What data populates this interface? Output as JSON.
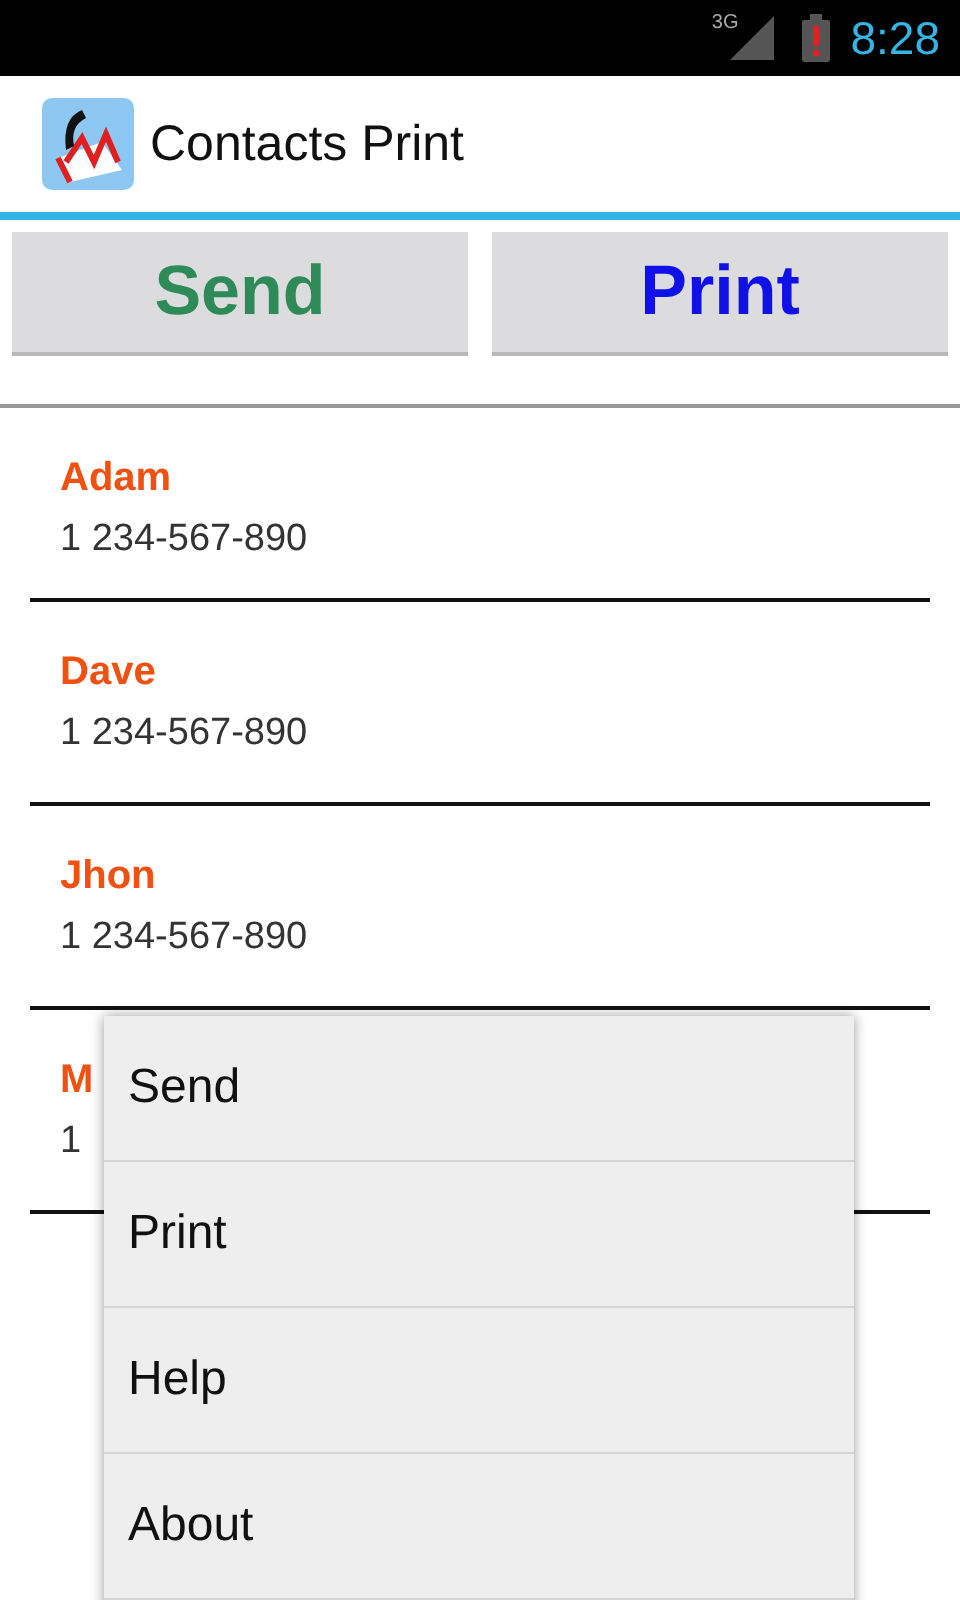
{
  "status_bar": {
    "network": "3G",
    "time": "8:28"
  },
  "action_bar": {
    "title": "Contacts Print"
  },
  "buttons": [
    {
      "label": "Send",
      "kind": "send"
    },
    {
      "label": "Print",
      "kind": "print"
    }
  ],
  "contacts": [
    {
      "name": "Adam",
      "phone": "1 234-567-890"
    },
    {
      "name": "Dave",
      "phone": "1 234-567-890"
    },
    {
      "name": "Jhon",
      "phone": "1 234-567-890"
    },
    {
      "name": "M",
      "phone": "1"
    }
  ],
  "menu": {
    "items": [
      "Send",
      "Print",
      "Help",
      "About"
    ]
  }
}
